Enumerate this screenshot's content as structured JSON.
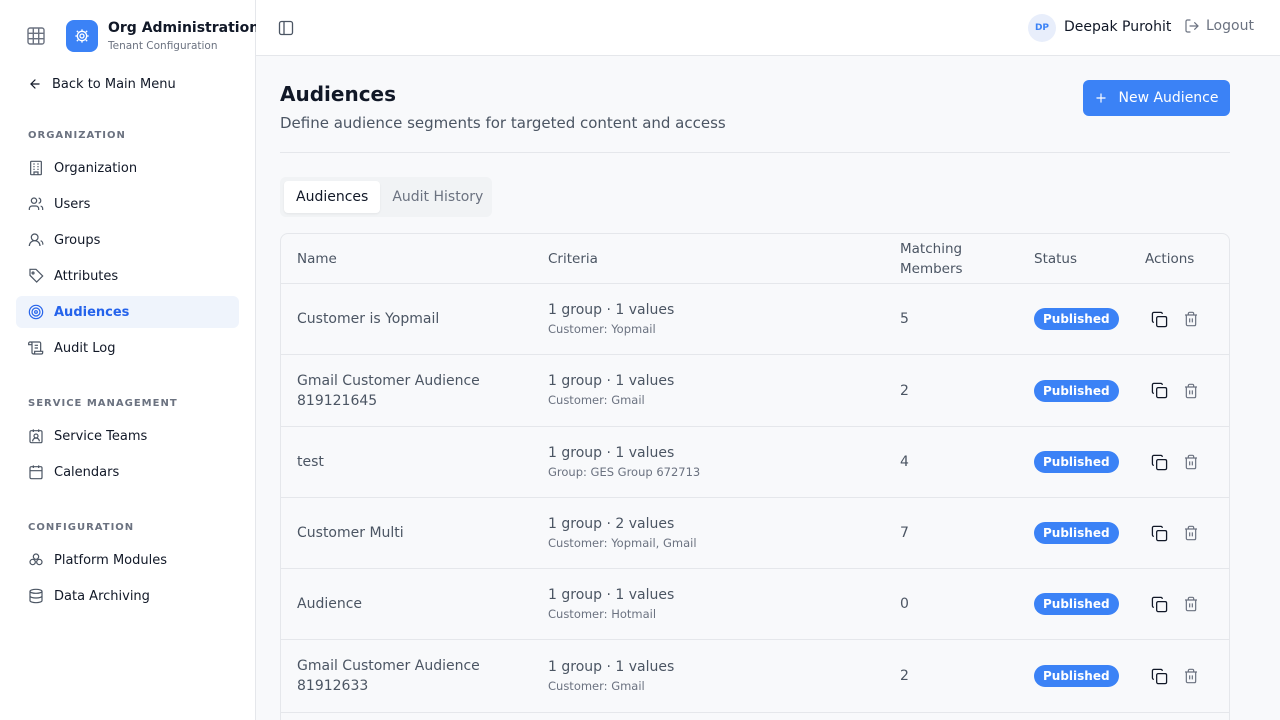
{
  "app": {
    "title": "Org Administration",
    "subtitle": "Tenant Configuration"
  },
  "sidebar": {
    "back_label": "Back to Main Menu",
    "sections": [
      {
        "label": "ORGANIZATION",
        "items": [
          {
            "label": "Organization",
            "icon": "building-icon"
          },
          {
            "label": "Users",
            "icon": "users-icon"
          },
          {
            "label": "Groups",
            "icon": "group-icon"
          },
          {
            "label": "Attributes",
            "icon": "tag-icon"
          },
          {
            "label": "Audiences",
            "icon": "target-icon",
            "active": true
          },
          {
            "label": "Audit Log",
            "icon": "scroll-icon"
          }
        ]
      },
      {
        "label": "SERVICE MANAGEMENT",
        "items": [
          {
            "label": "Service Teams",
            "icon": "contact-icon"
          },
          {
            "label": "Calendars",
            "icon": "calendar-icon"
          }
        ]
      },
      {
        "label": "CONFIGURATION",
        "items": [
          {
            "label": "Platform Modules",
            "icon": "modules-icon"
          },
          {
            "label": "Data Archiving",
            "icon": "database-icon"
          }
        ]
      }
    ]
  },
  "topbar": {
    "user_initials": "DP",
    "user_name": "Deepak Purohit",
    "logout_label": "Logout"
  },
  "main": {
    "title": "Audiences",
    "subtitle": "Define audience segments for targeted content and access",
    "new_button_label": "New Audience",
    "tabs": [
      {
        "label": "Audiences",
        "active": true
      },
      {
        "label": "Audit History"
      }
    ],
    "table": {
      "headers": {
        "name": "Name",
        "criteria": "Criteria",
        "members": "Matching Members",
        "status": "Status",
        "actions": "Actions"
      },
      "rows": [
        {
          "name": "Customer is Yopmail",
          "criteria": "1 group · 1 values",
          "criteria_detail": "Customer: Yopmail",
          "members": "5",
          "status": "Published"
        },
        {
          "name": "Gmail Customer Audience 819121645",
          "criteria": "1 group · 1 values",
          "criteria_detail": "Customer: Gmail",
          "members": "2",
          "status": "Published"
        },
        {
          "name": "test",
          "criteria": "1 group · 1 values",
          "criteria_detail": "Group: GES Group 672713",
          "members": "4",
          "status": "Published"
        },
        {
          "name": "Customer Multi",
          "criteria": "1 group · 2 values",
          "criteria_detail": "Customer: Yopmail, Gmail",
          "members": "7",
          "status": "Published"
        },
        {
          "name": "Audience",
          "criteria": "1 group · 1 values",
          "criteria_detail": "Customer: Hotmail",
          "members": "0",
          "status": "Published"
        },
        {
          "name": "Gmail Customer Audience 81912633",
          "criteria": "1 group · 1 values",
          "criteria_detail": "Customer: Gmail",
          "members": "2",
          "status": "Published"
        }
      ]
    }
  },
  "colors": {
    "accent": "#3b82f6",
    "active_bg": "#eff4fc",
    "border": "#e5e7eb"
  }
}
